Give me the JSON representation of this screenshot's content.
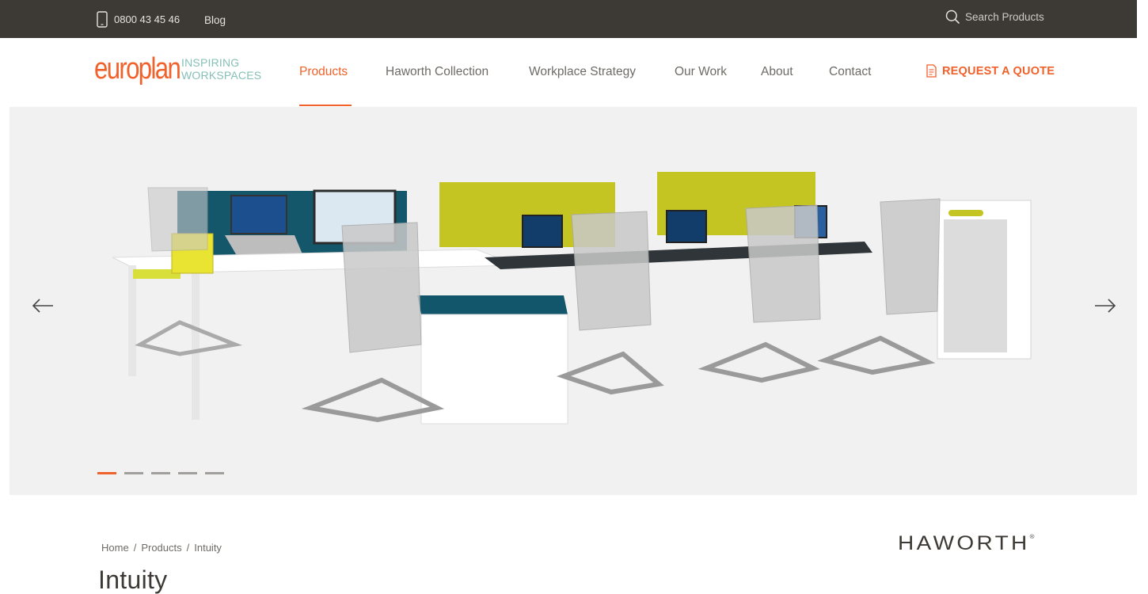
{
  "topbar": {
    "phone": "0800 43 45 46",
    "blog_label": "Blog",
    "search_placeholder": "Search Products"
  },
  "logo": {
    "wordmark": "europlan",
    "tagline_line1": "INSPIRING",
    "tagline_line2": "WORKSPACES"
  },
  "nav": {
    "items": [
      {
        "label": "Products",
        "active": true
      },
      {
        "label": "Haworth Collection",
        "active": false
      },
      {
        "label": "Workplace Strategy",
        "active": false
      },
      {
        "label": "Our Work",
        "active": false
      },
      {
        "label": "About",
        "active": false
      },
      {
        "label": "Contact",
        "active": false
      }
    ],
    "quote_label": "REQUEST A QUOTE"
  },
  "hero": {
    "image_alt": "Haworth Intuity bench desking with task chairs",
    "slide_count": 5,
    "active_slide": 1,
    "prev_icon": "arrow-left-icon",
    "next_icon": "arrow-right-icon"
  },
  "breadcrumb": {
    "items": [
      "Home",
      "Products",
      "Intuity"
    ],
    "separator": "/"
  },
  "page": {
    "title": "Intuity",
    "brand": "HAWORTH",
    "brand_mark": "®"
  },
  "colors": {
    "accent": "#f0612b",
    "topbar_bg": "#3d3935",
    "nav_text": "#6e6b67",
    "tagline": "#86c0b6",
    "hero_bg": "#f1f1f1"
  }
}
